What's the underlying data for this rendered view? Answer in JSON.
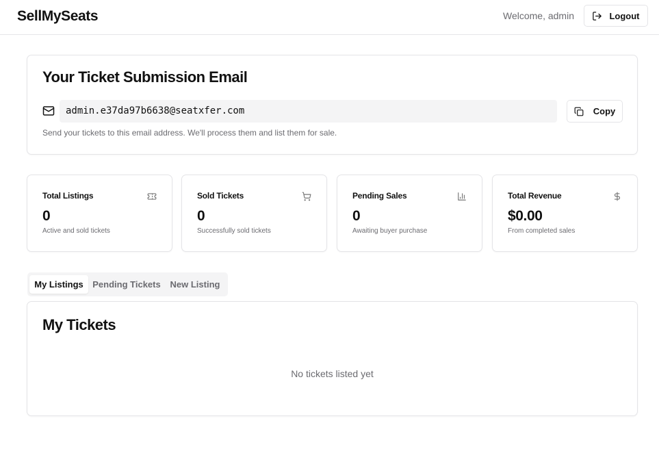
{
  "header": {
    "brand": "SellMySeats",
    "welcome": "Welcome, admin",
    "logout_label": "Logout"
  },
  "email_card": {
    "title": "Your Ticket Submission Email",
    "email": "admin.e37da97b6638@seatxfer.com",
    "copy_label": "Copy",
    "help_text": "Send your tickets to this email address. We'll process them and list them for sale."
  },
  "stats": [
    {
      "title": "Total Listings",
      "value": "0",
      "subtitle": "Active and sold tickets",
      "icon": "ticket-icon"
    },
    {
      "title": "Sold Tickets",
      "value": "0",
      "subtitle": "Successfully sold tickets",
      "icon": "cart-icon"
    },
    {
      "title": "Pending Sales",
      "value": "0",
      "subtitle": "Awaiting buyer purchase",
      "icon": "bar-chart-icon"
    },
    {
      "title": "Total Revenue",
      "value": "$0.00",
      "subtitle": "From completed sales",
      "icon": "dollar-icon"
    }
  ],
  "tabs": [
    {
      "label": "My Listings",
      "active": true
    },
    {
      "label": "Pending Tickets",
      "active": false
    },
    {
      "label": "New Listing",
      "active": false
    }
  ],
  "tickets": {
    "title": "My Tickets",
    "empty_text": "No tickets listed yet"
  },
  "colors": {
    "border": "#e4e4e7",
    "muted_text": "#6b6b70",
    "muted_bg": "#f4f4f5"
  }
}
